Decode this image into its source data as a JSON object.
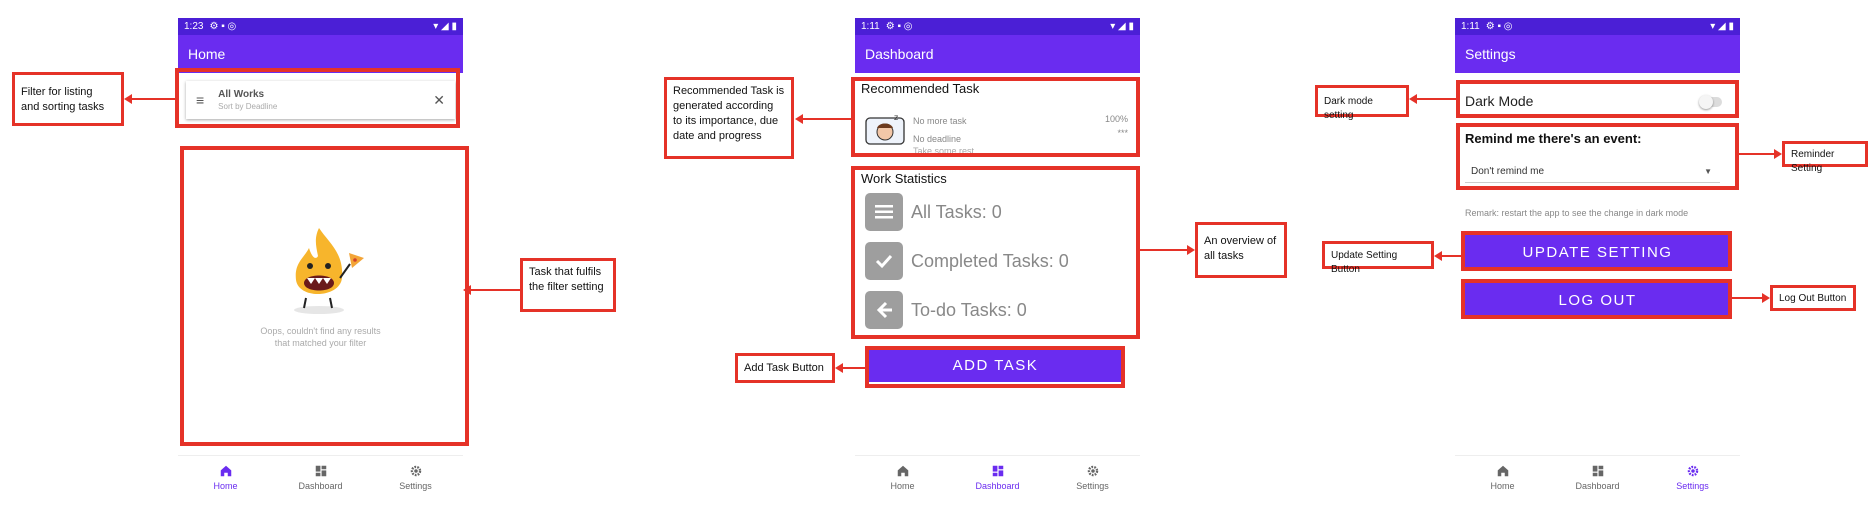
{
  "screens": {
    "home": {
      "status_time": "1:23",
      "title": "Home",
      "filter": {
        "label": "All Works",
        "sublabel": "Sort by Deadline"
      },
      "empty_text_1": "Oops, couldn't find any results",
      "empty_text_2": "that matched your filter"
    },
    "dashboard": {
      "status_time": "1:11",
      "title": "Dashboard",
      "recommended": {
        "heading": "Recommended Task",
        "task": "No more task",
        "deadline": "No deadline",
        "note": "Take some rest...",
        "percent": "100%",
        "stars": "***"
      },
      "stats": {
        "heading": "Work Statistics",
        "all": "All Tasks: 0",
        "completed": "Completed Tasks: 0",
        "todo": "To-do Tasks: 0"
      },
      "add_task": "ADD TASK"
    },
    "settings": {
      "status_time": "1:11",
      "title": "Settings",
      "dark_mode": "Dark Mode",
      "remind_heading": "Remind me there's an event:",
      "remind_value": "Don't remind me",
      "remark": "Remark: restart the app to see the change in dark mode",
      "update": "UPDATE SETTING",
      "logout": "LOG OUT"
    }
  },
  "nav": {
    "home": "Home",
    "dashboard": "Dashboard",
    "settings": "Settings"
  },
  "annotations": {
    "filter_line1": "Filter for listing",
    "filter_line2": "and sorting tasks",
    "task_line1": "Task that fulfils",
    "task_line2": "the filter setting",
    "recommended_line1": "Recommended Task is",
    "recommended_line2": "generated according",
    "recommended_line3": "to its importance, due",
    "recommended_line4": "date and progress",
    "overview_line1": "An overview of",
    "overview_line2": "all tasks",
    "add_task": "Add Task Button",
    "dark_mode": "Dark mode setting",
    "reminder": "Reminder Setting",
    "update": "Update Setting Button",
    "logout": "Log Out Button"
  },
  "colors": {
    "primary": "#6a2cf0",
    "status": "#4b1fd6",
    "annotation": "#e53228"
  }
}
